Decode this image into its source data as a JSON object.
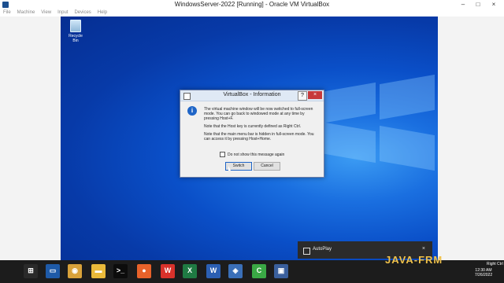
{
  "window": {
    "title": "WindowsServer-2022 [Running] - Oracle VM VirtualBox",
    "controls": {
      "minimize": "–",
      "maximize": "□",
      "close": "×"
    }
  },
  "menubar": [
    "File",
    "Machine",
    "View",
    "Input",
    "Devices",
    "Help"
  ],
  "desktop": {
    "recycle_bin_label": "Recycle Bin"
  },
  "dialog": {
    "title": "VirtualBox - Information",
    "help": "?",
    "close": "×",
    "info_glyph": "i",
    "paragraph1": "The virtual machine window will be now switched to full-screen mode. You can go back to windowed mode at any time by pressing Host+F.",
    "paragraph2": "Note that the Host key is currently defined as Right Ctrl.",
    "paragraph3": "Note that the main menu bar is hidden in full-screen mode. You can access it by pressing Host+Home.",
    "checkbox_label": "Do not show this message again",
    "switch_button": "Switch",
    "cancel_button": "Cancel"
  },
  "autoplay": {
    "label": "AutoPlay",
    "close": "×"
  },
  "clock": {
    "time": "12:30 AM",
    "date": "7/26/2022"
  },
  "taskbar": {
    "items": [
      {
        "name": "windows-logo-icon",
        "glyph": "⊞",
        "color": "#2a2a2a"
      },
      {
        "name": "server-manager-icon",
        "glyph": "▭",
        "color": "#1e5aa8"
      },
      {
        "name": "chrome-icon",
        "glyph": "◉",
        "color": "#d9a23a"
      },
      {
        "name": "file-explorer-icon",
        "glyph": "▬",
        "color": "#e9b93a"
      },
      {
        "name": "terminal-icon",
        "glyph": ">_",
        "color": "#0c0c0c"
      },
      {
        "name": "firefox-icon",
        "glyph": "●",
        "color": "#e8622a"
      },
      {
        "name": "wps-icon",
        "glyph": "W",
        "color": "#d9322b"
      },
      {
        "name": "excel-icon",
        "glyph": "X",
        "color": "#1f7a43"
      },
      {
        "name": "word-icon",
        "glyph": "W",
        "color": "#2b5fb3"
      },
      {
        "name": "virtualbox-icon",
        "glyph": "◈",
        "color": "#3a6fb8"
      },
      {
        "name": "camtasia-icon",
        "glyph": "C",
        "color": "#3aa845"
      },
      {
        "name": "vm-running-icon",
        "glyph": "▣",
        "color": "#3a5f9c"
      }
    ]
  },
  "watermark": {
    "text": "JAVA-FRM",
    "right_text": "Right Ctrl"
  }
}
